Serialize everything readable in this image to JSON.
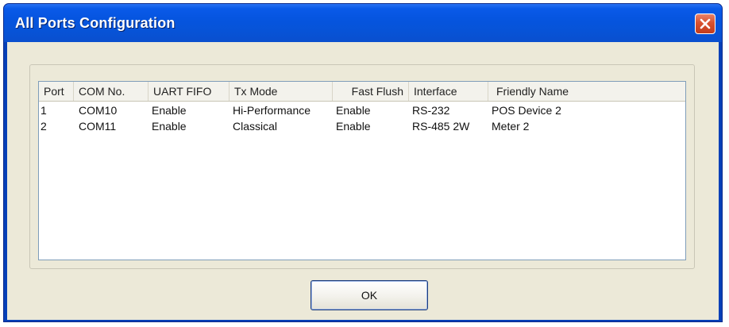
{
  "window": {
    "title": "All Ports Configuration",
    "close_icon": "close-icon"
  },
  "table": {
    "columns": [
      "Port",
      "COM No.",
      "UART FIFO",
      "Tx Mode",
      "Fast Flush",
      "Interface",
      "Friendly Name"
    ],
    "rows": [
      [
        "1",
        "COM10",
        "Enable",
        "Hi-Performance",
        "Enable",
        "RS-232",
        "POS Device 2"
      ],
      [
        "2",
        "COM11",
        "Enable",
        "Classical",
        "Enable",
        "RS-485 2W",
        "Meter 2"
      ]
    ]
  },
  "buttons": {
    "ok_label": "OK"
  },
  "colors": {
    "titlebar": "#0a5ae8",
    "close_button": "#d9512f",
    "dialog_face": "#ece9d8"
  }
}
